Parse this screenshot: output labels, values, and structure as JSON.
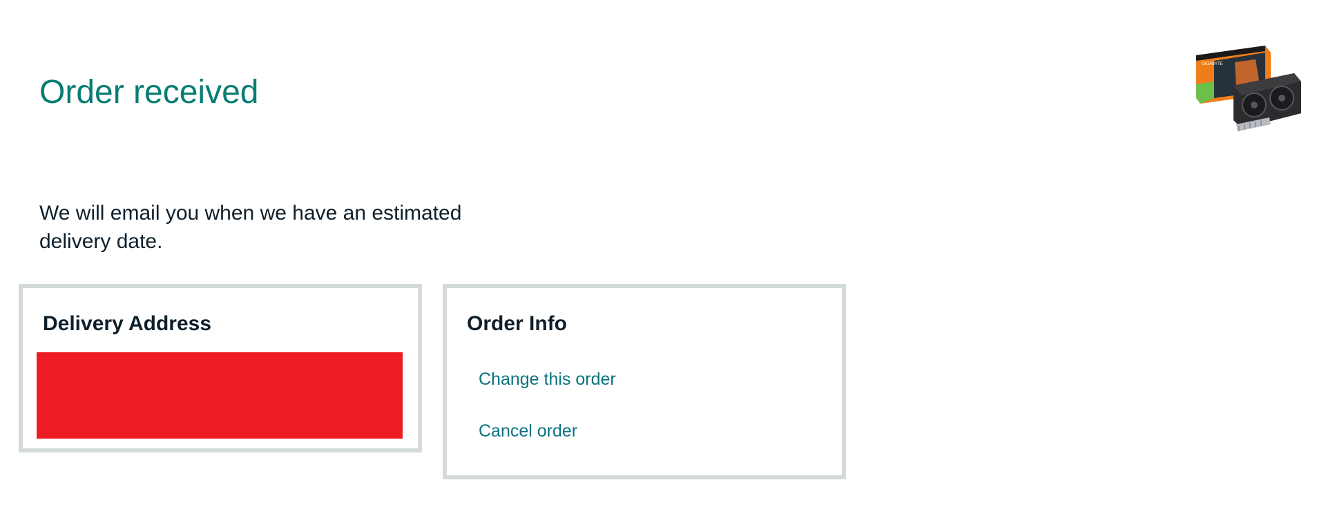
{
  "header": {
    "title": "Order received"
  },
  "product": {
    "image_alt": "Graphics card product image",
    "brand_text": "GIGABYTE"
  },
  "message": {
    "delivery_note": "We will email you when we have an estimated delivery date."
  },
  "delivery_address": {
    "heading": "Delivery Address"
  },
  "order_info": {
    "heading": "Order Info",
    "links": [
      {
        "label": "Change this order"
      },
      {
        "label": "Cancel order"
      }
    ]
  },
  "colors": {
    "title": "#067d73",
    "link": "#0b7380",
    "text": "#0f1f2a",
    "card_border": "#d5dbdb",
    "redaction": "#ed1c24"
  }
}
